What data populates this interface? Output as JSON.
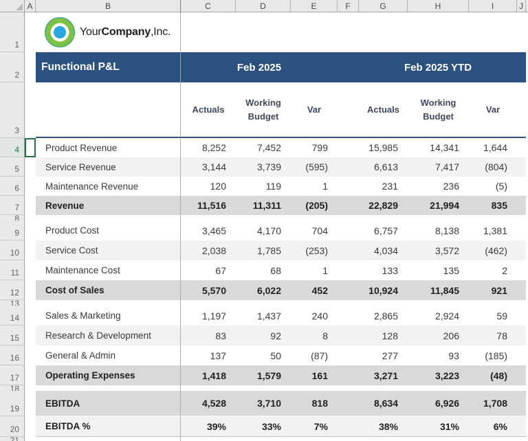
{
  "spreadsheet": {
    "column_letters": [
      "A",
      "B",
      "C",
      "D",
      "E",
      "F",
      "G",
      "H",
      "I",
      "J"
    ],
    "row_numbers": [
      "1",
      "2",
      "3",
      "4",
      "5",
      "6",
      "7",
      "8",
      "9",
      "10",
      "11",
      "12",
      "13",
      "14",
      "15",
      "16",
      "17",
      "18",
      "19",
      "20",
      "21"
    ],
    "selected_cell_row": "4"
  },
  "logo": {
    "part1": "Your",
    "part2": "Company",
    "part3": ",Inc."
  },
  "banner": {
    "title": "Functional P&L",
    "period_label": "Feb 2025",
    "ytd_label": "Feb 2025 YTD"
  },
  "subheaders": {
    "actuals": "Actuals",
    "working_budget": "Working Budget",
    "var": "Var"
  },
  "rows": [
    {
      "label": "Product Revenue",
      "values": [
        "8,252",
        "7,452",
        "799",
        "15,985",
        "14,341",
        "1,644"
      ],
      "style": "plain"
    },
    {
      "label": "Service Revenue",
      "values": [
        "3,144",
        "3,739",
        "(595)",
        "6,613",
        "7,417",
        "(804)"
      ],
      "style": "light"
    },
    {
      "label": "Maintenance Revenue",
      "values": [
        "120",
        "119",
        "1",
        "231",
        "236",
        "(5)"
      ],
      "style": "plain"
    },
    {
      "label": "Revenue",
      "values": [
        "11,516",
        "11,311",
        "(205)",
        "22,829",
        "21,994",
        "835"
      ],
      "style": "total"
    },
    {
      "label": "Product Cost",
      "values": [
        "3,465",
        "4,170",
        "704",
        "6,757",
        "8,138",
        "1,381"
      ],
      "style": "plain"
    },
    {
      "label": "Service Cost",
      "values": [
        "2,038",
        "1,785",
        "(253)",
        "4,034",
        "3,572",
        "(462)"
      ],
      "style": "light"
    },
    {
      "label": "Maintenance Cost",
      "values": [
        "67",
        "68",
        "1",
        "133",
        "135",
        "2"
      ],
      "style": "plain"
    },
    {
      "label": "Cost of Sales",
      "values": [
        "5,570",
        "6,022",
        "452",
        "10,924",
        "11,845",
        "921"
      ],
      "style": "total"
    },
    {
      "label": "Sales & Marketing",
      "values": [
        "1,197",
        "1,437",
        "240",
        "2,865",
        "2,924",
        "59"
      ],
      "style": "plain"
    },
    {
      "label": "Research & Development",
      "values": [
        "83",
        "92",
        "8",
        "128",
        "206",
        "78"
      ],
      "style": "light"
    },
    {
      "label": "General & Admin",
      "values": [
        "137",
        "50",
        "(87)",
        "277",
        "93",
        "(185)"
      ],
      "style": "plain"
    },
    {
      "label": "Operating Expenses",
      "values": [
        "1,418",
        "1,579",
        "161",
        "3,271",
        "3,223",
        "(48)"
      ],
      "style": "total"
    },
    {
      "label": "EBITDA",
      "values": [
        "4,528",
        "3,710",
        "818",
        "8,634",
        "6,926",
        "1,708"
      ],
      "style": "total"
    },
    {
      "label": "EBITDA %",
      "values": [
        "39%",
        "33%",
        "7%",
        "38%",
        "31%",
        "6%"
      ],
      "style": "pct"
    }
  ],
  "colors": {
    "banner_blue": "#2B5180",
    "subheader_text": "#3E4A5C",
    "total_band": "#D9D9D9",
    "light_band": "#F2F2F2",
    "selection_green": "#217346",
    "logo_outer": "#2E9B8F",
    "logo_ring": "#7DC242",
    "logo_core": "#29A8DF"
  }
}
